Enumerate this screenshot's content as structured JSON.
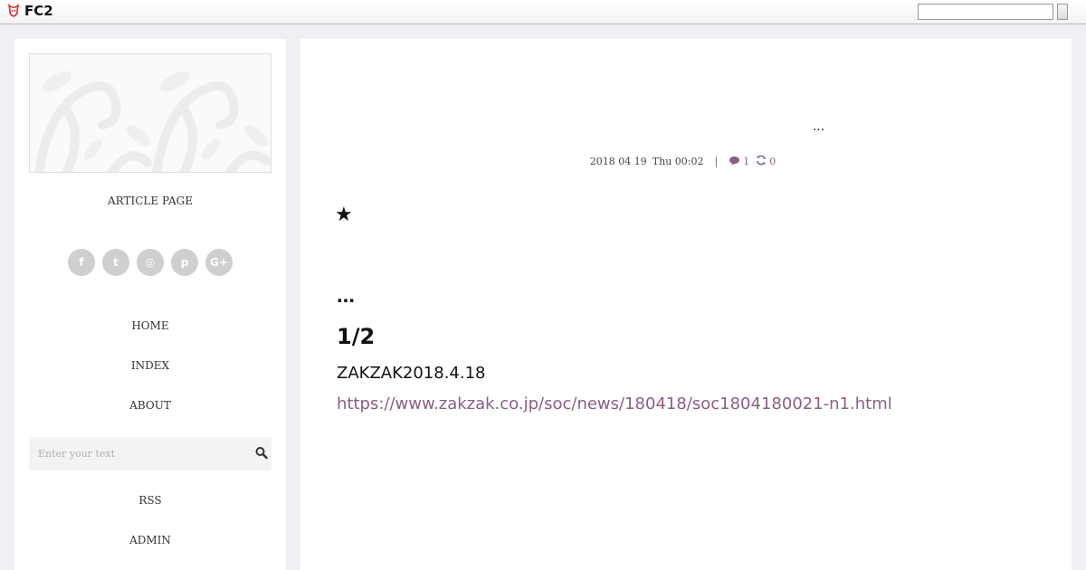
{
  "topbar": {
    "logo_text": "FC2",
    "search_value": "",
    "logo_color": "#d7332b"
  },
  "sidebar": {
    "site_title": "ARTICLE PAGE",
    "social": [
      {
        "icon": "facebook-icon",
        "glyph": "f"
      },
      {
        "icon": "twitter-icon",
        "glyph": "t"
      },
      {
        "icon": "instagram-icon",
        "glyph": "◎"
      },
      {
        "icon": "pinterest-icon",
        "glyph": "p"
      },
      {
        "icon": "google-plus-icon",
        "glyph": "G+"
      }
    ],
    "nav": {
      "home": "HOME",
      "index": "INDEX",
      "about": "ABOUT",
      "rss": "RSS",
      "admin": "ADMIN"
    },
    "search_placeholder": "Enter your text"
  },
  "post": {
    "title": "...",
    "date": "2018 04 19",
    "weekday_time": "Thu 00:02",
    "separator": "|",
    "comment_count": "1",
    "trackback_count": "0",
    "star": "★",
    "heading_dots": "...",
    "heading_half": "1/2",
    "source": "ZAKZAK2018.4.18",
    "link": "https://www.zakzak.co.jp/soc/news/180418/soc1804180021-n1.html"
  },
  "colors": {
    "accent": "#8a5d86",
    "page_bg": "#eef0f5",
    "social_bg": "#cfcfcf"
  }
}
